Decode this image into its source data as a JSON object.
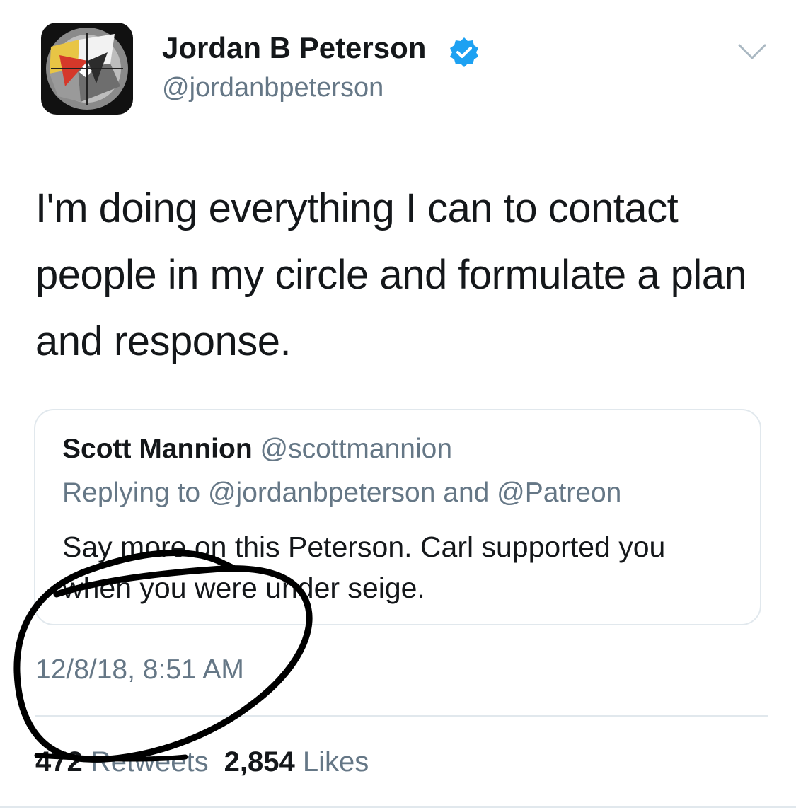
{
  "tweet": {
    "author_name": "Jordan B Peterson",
    "author_handle": "@jordanbpeterson",
    "verified_icon": "verified-badge-icon",
    "menu_icon": "chevron-down-icon",
    "text": "I'm doing everything I can to contact people in my circle and formulate a plan and response.",
    "timestamp": "12/8/18, 8:51 AM"
  },
  "quoted_tweet": {
    "author_name": "Scott Mannion",
    "author_handle": "@scottmannion",
    "replying_to": "Replying to @jordanbpeterson and @Patreon",
    "text": "Say more on this Peterson. Carl supported you when you were under seige."
  },
  "stats": {
    "retweets_count": "472",
    "retweets_label": "Retweets",
    "likes_count": "2,854",
    "likes_label": "Likes"
  },
  "colors": {
    "text_primary": "#14171a",
    "text_secondary": "#657786",
    "verified_blue": "#1da1f2",
    "border": "#e1e8ed",
    "annotation_ink": "#000000"
  }
}
